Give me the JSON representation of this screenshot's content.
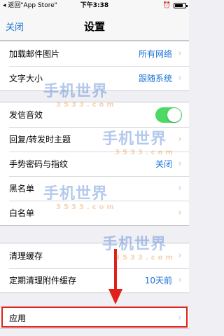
{
  "status_bar": {
    "back_text": "返回\"App Store\"",
    "time": "下午3:38",
    "battery_level": 0.8
  },
  "nav": {
    "close_label": "关闭",
    "title": "设置"
  },
  "groups": [
    {
      "rows": [
        {
          "label": "加载邮件图片",
          "value": "所有网络"
        },
        {
          "label": "文字大小",
          "value": "跟随系统"
        }
      ]
    },
    {
      "rows": [
        {
          "label": "发信音效",
          "toggle": true
        },
        {
          "label": "回复/转发时主题",
          "value": ""
        },
        {
          "label": "手势密码与指纹",
          "value": "关闭"
        },
        {
          "label": "黑名单",
          "value": ""
        },
        {
          "label": "白名单",
          "value": ""
        }
      ]
    },
    {
      "rows": [
        {
          "label": "清理缓存",
          "value": ""
        },
        {
          "label": "定期清理附件缓存",
          "value": "10天前"
        }
      ]
    },
    {
      "rows": [
        {
          "label": "应用",
          "value": ""
        }
      ]
    }
  ],
  "watermark": {
    "text": "手机世界",
    "sub": "3533.com"
  },
  "colors": {
    "accent": "#1a73d6",
    "toggle_on": "#4cd964",
    "highlight": "#e0201b"
  }
}
